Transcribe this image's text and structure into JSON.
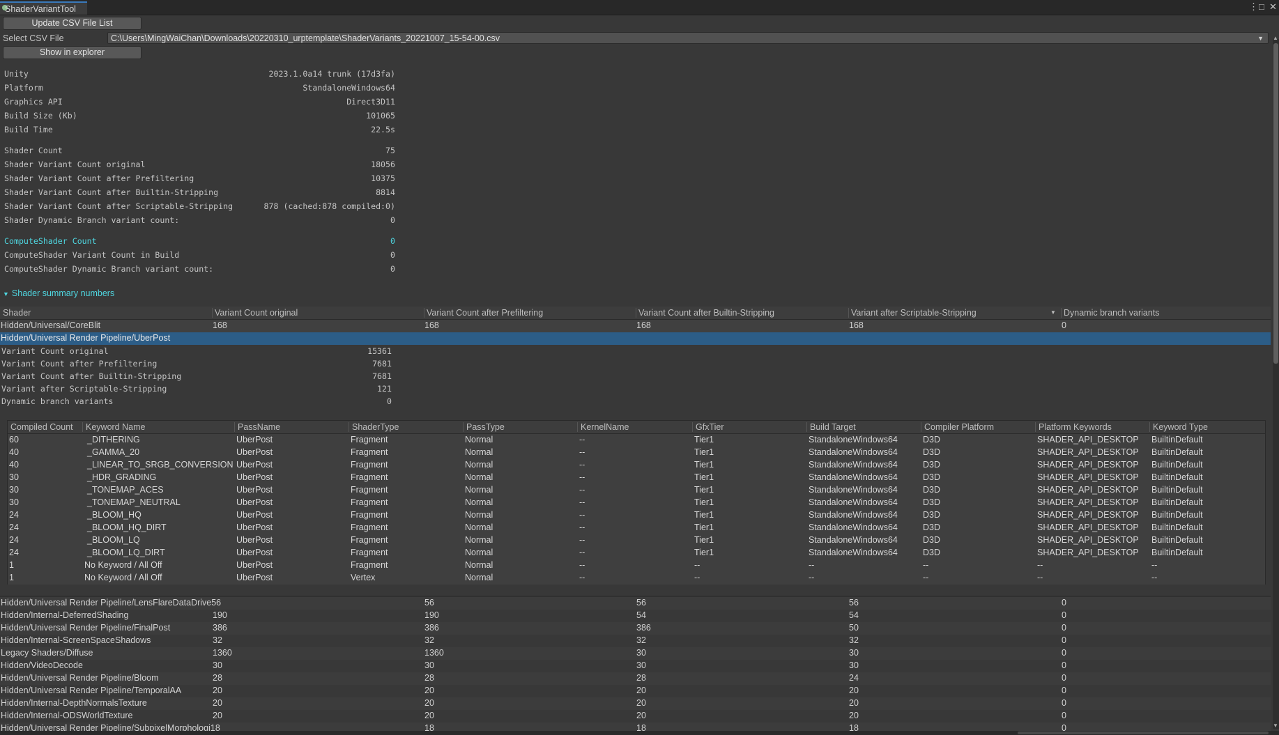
{
  "window": {
    "tab_title": "ShaderVariantTool",
    "menu_icon": "⋮",
    "maximize_icon": "□",
    "close_icon": "✕"
  },
  "toolbar": {
    "update_button": "Update CSV File List",
    "select_label": "Select CSV File",
    "csv_path": "C:\\Users\\MingWaiChan\\Downloads\\20220310_urptemplate\\ShaderVariants_20221007_15-54-00.csv",
    "explorer_button": "Show in explorer"
  },
  "build_info": [
    {
      "label": "Unity",
      "value": "2023.1.0a14 trunk (17d3fa)"
    },
    {
      "label": "Platform",
      "value": "StandaloneWindows64"
    },
    {
      "label": "Graphics API",
      "value": "Direct3D11"
    },
    {
      "label": "Build Size (Kb)",
      "value": "101065"
    },
    {
      "label": "Build Time",
      "value": "22.5s"
    }
  ],
  "shader_info": [
    {
      "label": "Shader Count",
      "value": "75"
    },
    {
      "label": "Shader Variant Count original",
      "value": "18056"
    },
    {
      "label": "Shader Variant Count after Prefiltering",
      "value": "10375"
    },
    {
      "label": "Shader Variant Count after Builtin-Stripping",
      "value": "8814"
    },
    {
      "label": "Shader Variant Count after Scriptable-Stripping",
      "value": "878 (cached:878 compiled:0)"
    },
    {
      "label": "Shader Dynamic Branch variant count:",
      "value": "0"
    }
  ],
  "compute_info": [
    {
      "label": "ComputeShader Count",
      "value": "0"
    },
    {
      "label": "ComputeShader Variant Count in Build",
      "value": "0"
    },
    {
      "label": "ComputeShader Dynamic Branch variant count:",
      "value": "0"
    }
  ],
  "summary": {
    "foldout_label": "Shader summary numbers",
    "headers": [
      "Shader",
      "Variant Count original",
      "Variant Count after Prefiltering",
      "Variant Count after Builtin-Stripping",
      "Variant after Scriptable-Stripping",
      "Dynamic branch variants"
    ],
    "sort_icon": "▼",
    "first_row": [
      "Hidden/Universal/CoreBlit",
      "168",
      "168",
      "168",
      "168",
      "0"
    ],
    "selected_shader": "Hidden/Universal Render Pipeline/UberPost",
    "selected_stats": [
      {
        "label": "Variant Count original",
        "value": "15361"
      },
      {
        "label": "Variant Count after Prefiltering",
        "value": "7681"
      },
      {
        "label": "Variant Count after Builtin-Stripping",
        "value": "7681"
      },
      {
        "label": "Variant after Scriptable-Stripping",
        "value": "121"
      },
      {
        "label": "Dynamic branch variants",
        "value": "0"
      }
    ],
    "rows": [
      [
        "Hidden/Universal Render Pipeline/LensFlareDataDrive56",
        "",
        "56",
        "56",
        "56",
        "0"
      ],
      [
        "Hidden/Internal-DeferredShading",
        "190",
        "190",
        "54",
        "54",
        "0"
      ],
      [
        "Hidden/Universal Render Pipeline/FinalPost",
        "386",
        "386",
        "386",
        "50",
        "0"
      ],
      [
        "Hidden/Internal-ScreenSpaceShadows",
        "32",
        "32",
        "32",
        "32",
        "0"
      ],
      [
        "Legacy Shaders/Diffuse",
        "1360",
        "1360",
        "30",
        "30",
        "0"
      ],
      [
        "Hidden/VideoDecode",
        "30",
        "30",
        "30",
        "30",
        "0"
      ],
      [
        "Hidden/Universal Render Pipeline/Bloom",
        "28",
        "28",
        "28",
        "24",
        "0"
      ],
      [
        "Hidden/Universal Render Pipeline/TemporalAA",
        "20",
        "20",
        "20",
        "20",
        "0"
      ],
      [
        "Hidden/Internal-DepthNormalsTexture",
        "20",
        "20",
        "20",
        "20",
        "0"
      ],
      [
        "Hidden/Internal-ODSWorldTexture",
        "20",
        "20",
        "20",
        "20",
        "0"
      ],
      [
        "Hidden/Universal Render Pipeline/SubpixelMorphologi18",
        "",
        "18",
        "18",
        "18",
        "0"
      ]
    ]
  },
  "variants": {
    "headers": [
      "Compiled Count",
      "Keyword Name",
      "PassName",
      "ShaderType",
      "PassType",
      "KernelName",
      "GfxTier",
      "Build Target",
      "Compiler Platform",
      "Platform Keywords",
      "Keyword Type"
    ],
    "rows": [
      [
        "60",
        "_DITHERING",
        "UberPost",
        "Fragment",
        "Normal",
        "--",
        "Tier1",
        "StandaloneWindows64",
        "D3D",
        "SHADER_API_DESKTOP",
        "BuiltinDefault"
      ],
      [
        "40",
        "_GAMMA_20",
        "UberPost",
        "Fragment",
        "Normal",
        "--",
        "Tier1",
        "StandaloneWindows64",
        "D3D",
        "SHADER_API_DESKTOP",
        "BuiltinDefault"
      ],
      [
        "40",
        "_LINEAR_TO_SRGB_CONVERSION",
        "UberPost",
        "Fragment",
        "Normal",
        "--",
        "Tier1",
        "StandaloneWindows64",
        "D3D",
        "SHADER_API_DESKTOP",
        "BuiltinDefault"
      ],
      [
        "30",
        "_HDR_GRADING",
        "UberPost",
        "Fragment",
        "Normal",
        "--",
        "Tier1",
        "StandaloneWindows64",
        "D3D",
        "SHADER_API_DESKTOP",
        "BuiltinDefault"
      ],
      [
        "30",
        "_TONEMAP_ACES",
        "UberPost",
        "Fragment",
        "Normal",
        "--",
        "Tier1",
        "StandaloneWindows64",
        "D3D",
        "SHADER_API_DESKTOP",
        "BuiltinDefault"
      ],
      [
        "30",
        "_TONEMAP_NEUTRAL",
        "UberPost",
        "Fragment",
        "Normal",
        "--",
        "Tier1",
        "StandaloneWindows64",
        "D3D",
        "SHADER_API_DESKTOP",
        "BuiltinDefault"
      ],
      [
        "24",
        "_BLOOM_HQ",
        "UberPost",
        "Fragment",
        "Normal",
        "--",
        "Tier1",
        "StandaloneWindows64",
        "D3D",
        "SHADER_API_DESKTOP",
        "BuiltinDefault"
      ],
      [
        "24",
        "_BLOOM_HQ_DIRT",
        "UberPost",
        "Fragment",
        "Normal",
        "--",
        "Tier1",
        "StandaloneWindows64",
        "D3D",
        "SHADER_API_DESKTOP",
        "BuiltinDefault"
      ],
      [
        "24",
        "_BLOOM_LQ",
        "UberPost",
        "Fragment",
        "Normal",
        "--",
        "Tier1",
        "StandaloneWindows64",
        "D3D",
        "SHADER_API_DESKTOP",
        "BuiltinDefault"
      ],
      [
        "24",
        "_BLOOM_LQ_DIRT",
        "UberPost",
        "Fragment",
        "Normal",
        "--",
        "Tier1",
        "StandaloneWindows64",
        "D3D",
        "SHADER_API_DESKTOP",
        "BuiltinDefault"
      ],
      [
        "1",
        "No Keyword / All Off",
        "UberPost",
        "Fragment",
        "Normal",
        "--",
        "--",
        "--",
        "--",
        "--",
        "--"
      ],
      [
        "1",
        "No Keyword / All Off",
        "UberPost",
        "Vertex",
        "Normal",
        "--",
        "--",
        "--",
        "--",
        "--",
        "--"
      ]
    ]
  }
}
